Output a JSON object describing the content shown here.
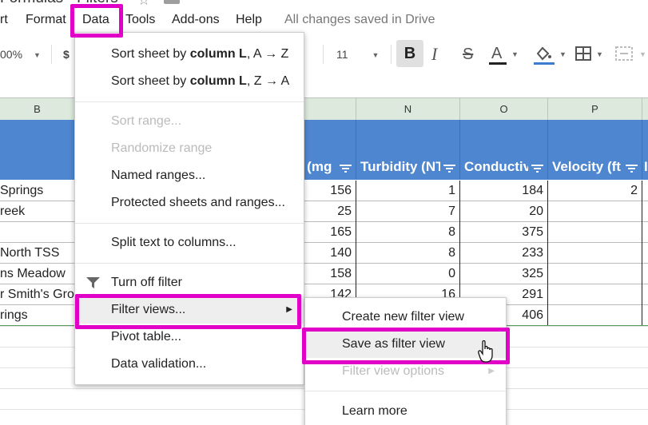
{
  "document": {
    "title": "Formulas - Filters"
  },
  "menubar": {
    "items": [
      "rt",
      "Format",
      "Data",
      "Tools",
      "Add-ons",
      "Help"
    ],
    "save_status": "All changes saved in Drive"
  },
  "toolbar": {
    "zoom": "00%",
    "currency": "$",
    "font_size": "11",
    "bold": "B",
    "italic": "I",
    "strikethrough": "S",
    "text_color": "A"
  },
  "grid": {
    "columns": [
      {
        "letter": "B"
      },
      {
        "letter": "N"
      },
      {
        "letter": "O"
      },
      {
        "letter": "P"
      }
    ],
    "headers": [
      {
        "label": "y (mg"
      },
      {
        "label": "Turbidity (NT"
      },
      {
        "label": "Conductiv"
      },
      {
        "label": "Velocity (ft"
      }
    ],
    "rows": [
      {
        "name": " Springs",
        "m": "156",
        "n": "1",
        "o": "184",
        "p": "2"
      },
      {
        "name": "reek",
        "m": "25",
        "n": "7",
        "o": "20",
        "p": ""
      },
      {
        "name": "",
        "m": "165",
        "n": "8",
        "o": "375",
        "p": ""
      },
      {
        "name": "North TSS",
        "m": "140",
        "n": "8",
        "o": "233",
        "p": ""
      },
      {
        "name": "ns Meadow",
        "m": "158",
        "n": "0",
        "o": "325",
        "p": ""
      },
      {
        "name": "r Smith's Gro",
        "m": "142",
        "n": "16",
        "o": "291",
        "p": ""
      },
      {
        "name": "rings",
        "m": "",
        "n": "",
        "o": "406",
        "p": ""
      }
    ]
  },
  "data_menu": {
    "sort_az_prefix": "Sort sheet by ",
    "sort_col": "column L",
    "sort_az_suffix": ", A → Z",
    "sort_za_suffix": ", Z → A",
    "sort_range": "Sort range...",
    "randomize_range": "Randomize range",
    "named_ranges": "Named ranges...",
    "protected": "Protected sheets and ranges...",
    "split_text": "Split text to columns...",
    "turn_off_filter": "Turn off filter",
    "filter_views": "Filter views...",
    "pivot_table": "Pivot table...",
    "data_validation": "Data validation..."
  },
  "filter_views_submenu": {
    "create_new": "Create new filter view",
    "save_as": "Save as filter view",
    "options": "Filter view options",
    "learn_more": "Learn more"
  },
  "colors": {
    "highlight": "#e000c8",
    "header_band": "#4f86d0",
    "accent": "#3d7ccf"
  }
}
